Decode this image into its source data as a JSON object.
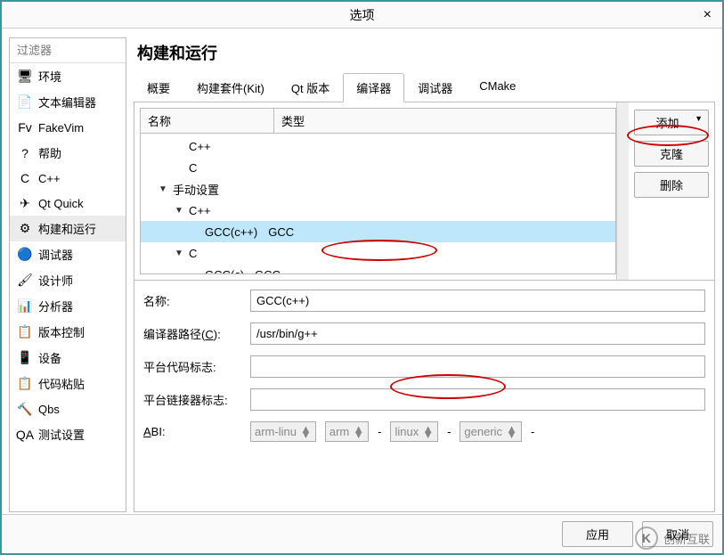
{
  "window": {
    "title": "选项",
    "close": "×"
  },
  "filter": {
    "placeholder": "过滤器"
  },
  "sidebar": {
    "items": [
      {
        "icon": "🖥",
        "label": "环境"
      },
      {
        "icon": "📄",
        "label": "文本编辑器"
      },
      {
        "icon": "Fv",
        "label": "FakeVim"
      },
      {
        "icon": "?",
        "label": "帮助"
      },
      {
        "icon": "C",
        "label": "C++"
      },
      {
        "icon": "✈",
        "label": "Qt Quick"
      },
      {
        "icon": "⚙",
        "label": "构建和运行"
      },
      {
        "icon": "🔵",
        "label": "调试器"
      },
      {
        "icon": "🖌",
        "label": "设计师"
      },
      {
        "icon": "📊",
        "label": "分析器"
      },
      {
        "icon": "📋",
        "label": "版本控制"
      },
      {
        "icon": "📱",
        "label": "设备"
      },
      {
        "icon": "📋",
        "label": "代码粘贴"
      },
      {
        "icon": "🔨",
        "label": "Qbs"
      },
      {
        "icon": "QA",
        "label": "测试设置"
      }
    ]
  },
  "main": {
    "title": "构建和运行",
    "tabs": [
      "概要",
      "构建套件(Kit)",
      "Qt 版本",
      "编译器",
      "调试器",
      "CMake"
    ],
    "active_tab": "编译器",
    "tree": {
      "headers": {
        "name": "名称",
        "type": "类型"
      },
      "rows": [
        {
          "indent": 2,
          "label": "C++",
          "type": ""
        },
        {
          "indent": 2,
          "label": "C",
          "type": ""
        },
        {
          "indent": 1,
          "arrow": "▼",
          "label": "手动设置",
          "type": ""
        },
        {
          "indent": 2,
          "arrow": "▼",
          "label": "C++",
          "type": ""
        },
        {
          "indent": 3,
          "label": "GCC(c++)",
          "type": "GCC",
          "selected": true
        },
        {
          "indent": 2,
          "arrow": "▼",
          "label": "C",
          "type": ""
        },
        {
          "indent": 3,
          "label": "GCC(c)",
          "type": "GCC"
        }
      ]
    },
    "buttons": {
      "add": "添加",
      "clone": "克隆",
      "delete": "删除"
    },
    "form": {
      "name_label": "名称:",
      "name_value": "GCC(c++)",
      "path_label": "编译器路径(C):",
      "path_value": "/usr/bin/g++",
      "codeflag_label": "平台代码标志:",
      "codeflag_value": "",
      "linkflag_label": "平台链接器标志:",
      "linkflag_value": "",
      "abi_label": "ABI:",
      "abi_sel": "arm-linu",
      "abi_parts": [
        "arm",
        "linux",
        "generic"
      ]
    }
  },
  "footer": {
    "apply": "应用",
    "cancel": "取消"
  },
  "watermark": {
    "text": "创新互联"
  }
}
